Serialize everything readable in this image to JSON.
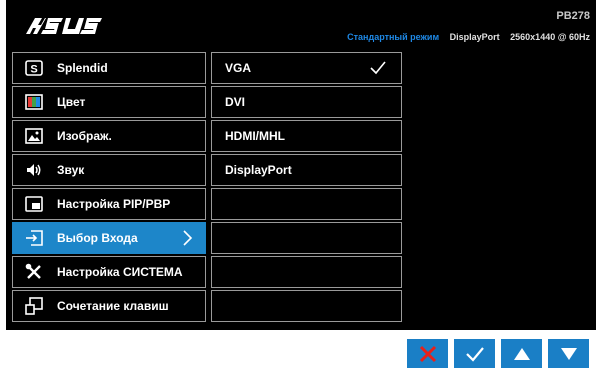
{
  "header": {
    "brand": "ASUS",
    "model": "PB278",
    "mode": "Стандартный режим",
    "port": "DisplayPort",
    "resolution": "2560x1440 @ 60Hz"
  },
  "menu": {
    "items": [
      {
        "label": "Splendid",
        "icon": "splendid-icon",
        "active": false
      },
      {
        "label": "Цвет",
        "icon": "color-icon",
        "active": false
      },
      {
        "label": "Изображ.",
        "icon": "image-icon",
        "active": false
      },
      {
        "label": "Звук",
        "icon": "speaker-icon",
        "active": false
      },
      {
        "label": "Настройка PIP/PBP",
        "icon": "pip-icon",
        "active": false
      },
      {
        "label": "Выбор Входа",
        "icon": "input-select-icon",
        "active": true
      },
      {
        "label": "Настройка СИСТЕМА",
        "icon": "tools-icon",
        "active": false
      },
      {
        "label": "Сочетание клавиш",
        "icon": "shortcut-icon",
        "active": false
      }
    ]
  },
  "submenu": {
    "items": [
      {
        "label": "VGA",
        "selected": true
      },
      {
        "label": "DVI",
        "selected": false
      },
      {
        "label": "HDMI/MHL",
        "selected": false
      },
      {
        "label": "DisplayPort",
        "selected": false
      },
      {
        "label": "",
        "selected": false
      },
      {
        "label": "",
        "selected": false
      },
      {
        "label": "",
        "selected": false
      },
      {
        "label": "",
        "selected": false
      }
    ]
  },
  "nav": {
    "buttons": [
      "close-icon",
      "check-icon",
      "up-arrow-icon",
      "down-arrow-icon"
    ]
  },
  "colors": {
    "accent": "#1d86c9",
    "mode_text": "#1e88e5",
    "nav_button": "#1a7fc6",
    "close_x": "#e8201a"
  }
}
